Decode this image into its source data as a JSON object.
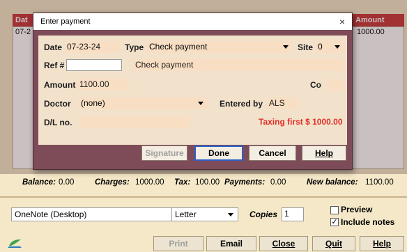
{
  "background": {
    "col_date": "Dat",
    "col_amount": "Amount",
    "row_date": "07-2",
    "row_amount": "1000.00"
  },
  "balance": {
    "balance_label": "Balance:",
    "balance_value": "0.00",
    "charges_label": "Charges:",
    "charges_value": "1000.00",
    "tax_label": "Tax:",
    "tax_value": "100.00",
    "payments_label": "Payments:",
    "payments_value": "0.00",
    "new_balance_label": "New balance:",
    "new_balance_value": "1100.00"
  },
  "printer": {
    "printer_value": "OneNote (Desktop)",
    "paper_value": "Letter",
    "copies_label": "Copies",
    "copies_value": "1",
    "preview_label": "Preview",
    "preview_checked": "",
    "include_notes_label": "Include notes",
    "include_notes_checked": "✓"
  },
  "buttons": {
    "print": "Print",
    "email": "Email",
    "close": "Close",
    "quit": "Quit",
    "help": "Help"
  },
  "dialog": {
    "title": "Enter payment",
    "close_glyph": "×",
    "date_label": "Date",
    "date_value": "07-23-24",
    "type_label": "Type",
    "type_value": "Check payment",
    "site_label": "Site",
    "site_value": "0",
    "ref_label": "Ref #",
    "ref_value": "",
    "description_value": "Check payment",
    "amount_label": "Amount",
    "amount_value": "1100.00",
    "co_label": "Co",
    "co_value": "",
    "doctor_label": "Doctor",
    "doctor_value": "(none)",
    "entered_by_label": "Entered by",
    "entered_by_value": "ALS",
    "dl_label": "D/L no.",
    "dl_value": "",
    "taxing_note": "Taxing first $ 1000.00",
    "signature_button": "Signature",
    "done_button": "Done",
    "cancel_button": "Cancel",
    "help_button": "Help"
  },
  "colors": {
    "accent": "#c83a3a",
    "dialog_frame": "#7d4c58",
    "panel": "#f2e2cc",
    "field": "#f8dfc4",
    "warning": "#e0302a"
  }
}
